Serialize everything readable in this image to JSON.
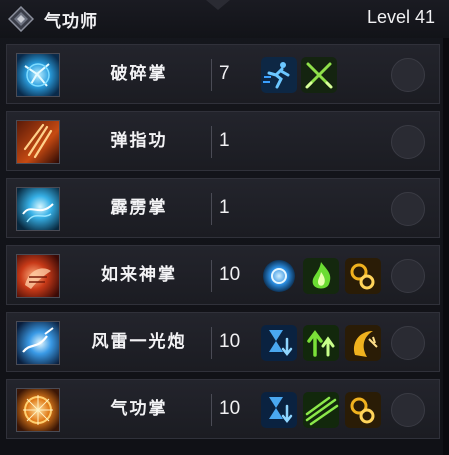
{
  "header": {
    "class_name": "气功师",
    "level": "Level 41",
    "emblem_icon": "diamond-emblem-icon"
  },
  "skills": [
    {
      "name": "破碎掌",
      "count": "7",
      "icon": "blue-shatter-palm-icon",
      "tags": [
        "dash-icon",
        "crossed-swords-icon"
      ]
    },
    {
      "name": "弹指功",
      "count": "1",
      "icon": "fire-flick-icon",
      "tags": []
    },
    {
      "name": "霹雳掌",
      "count": "1",
      "icon": "lightning-palm-icon",
      "tags": []
    },
    {
      "name": "如来神掌",
      "count": "10",
      "icon": "buddha-palm-icon",
      "tags": [
        "blue-orb-icon",
        "green-flame-icon",
        "gold-swirl-icon"
      ]
    },
    {
      "name": "风雷一光炮",
      "count": "10",
      "icon": "wind-thunder-cannon-icon",
      "tags": [
        "hourglass-down-icon",
        "green-arrows-up-icon",
        "gold-crescent-icon"
      ]
    },
    {
      "name": "气功掌",
      "count": "10",
      "icon": "qi-palm-icon",
      "tags": [
        "hourglass-down-icon",
        "green-slash-icon",
        "gold-swirl-icon"
      ]
    }
  ],
  "colors": {
    "panel_bg": "#15161c",
    "row_bg": "#23242c",
    "text": "#f1f1f3",
    "blue_accent": "#3aa0ff",
    "green_accent": "#5bd13a",
    "gold_accent": "#e6a21c"
  }
}
